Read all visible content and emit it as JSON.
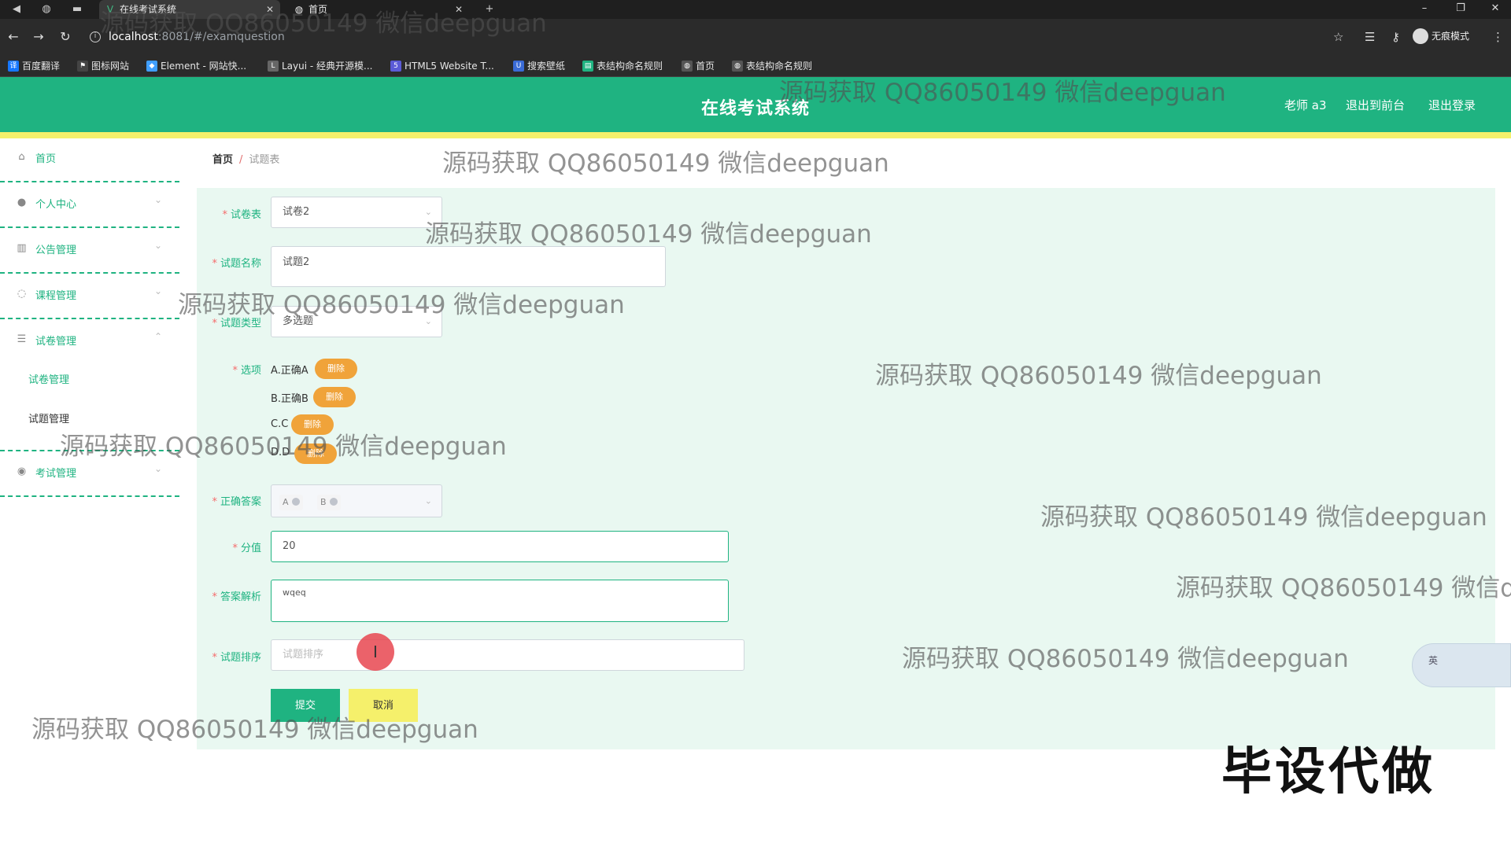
{
  "browser": {
    "tabs": [
      {
        "title": "在线考试系统",
        "active": true
      },
      {
        "title": "首页",
        "active": false
      }
    ],
    "url_host": "localhost",
    "url_path": ":8081/#/examquestion",
    "profile_label": "无痕模式",
    "bookmarks": [
      {
        "label": "百度翻译",
        "icon": "translate-icon",
        "color": "#1677ff"
      },
      {
        "label": "图标网站",
        "icon": "flag-icon",
        "color": "#444444"
      },
      {
        "label": "Element - 网站快...",
        "icon": "element-icon",
        "color": "#409eff"
      },
      {
        "label": "Layui - 经典开源模...",
        "icon": "layui-icon",
        "color": "#666666"
      },
      {
        "label": "HTML5 Website T...",
        "icon": "html5-icon",
        "color": "#5b5bd6"
      },
      {
        "label": "搜索壁纸",
        "icon": "u-icon",
        "color": "#3a6bd6"
      },
      {
        "label": "表结构命名规则",
        "icon": "sheet-icon",
        "color": "#1fb381"
      },
      {
        "label": "首页",
        "icon": "globe-icon",
        "color": "#555555"
      },
      {
        "label": "表结构命名规则",
        "icon": "globe-icon",
        "color": "#555555"
      }
    ]
  },
  "header": {
    "title": "在线考试系统",
    "user": "老师 a3",
    "to_front": "退出到前台",
    "logout": "退出登录"
  },
  "sidebar": {
    "items": [
      {
        "label": "首页",
        "icon": "home-icon"
      },
      {
        "label": "个人中心",
        "icon": "user-icon"
      },
      {
        "label": "公告管理",
        "icon": "chart-icon"
      },
      {
        "label": "课程管理",
        "icon": "lightbulb-icon"
      },
      {
        "label": "试卷管理",
        "icon": "sliders-icon"
      },
      {
        "label": "考试管理",
        "icon": "pin-icon"
      }
    ],
    "sub_items": [
      "试卷管理",
      "试题管理"
    ]
  },
  "breadcrumb": {
    "home": "首页",
    "current": "试题表"
  },
  "form": {
    "paper_label": "试卷表",
    "paper_value": "试卷2",
    "name_label": "试题名称",
    "name_value": "试题2",
    "type_label": "试题类型",
    "type_value": "多选题",
    "options_label": "选项",
    "options": [
      "A.正确A",
      "B.正确B",
      "C.C",
      "D.D"
    ],
    "delete_label": "删除",
    "answer_label": "正确答案",
    "answer_tags": [
      "A",
      "B"
    ],
    "score_label": "分值",
    "score_value": "20",
    "analysis_label": "答案解析",
    "analysis_value": "wqeq",
    "order_label": "试题排序",
    "order_placeholder": "试题排序",
    "submit": "提交",
    "cancel": "取消"
  },
  "overlay": {
    "watermark": "源码获取 QQ86050149 微信deepguan",
    "watermark_cut": "源码获取 QQ86050149 微信de",
    "big_text": "毕设代做",
    "ime_label": "英"
  },
  "colors": {
    "primary": "#1fb381",
    "accent_yellow": "#f5f06b",
    "delete_orange": "#f0a33a"
  }
}
